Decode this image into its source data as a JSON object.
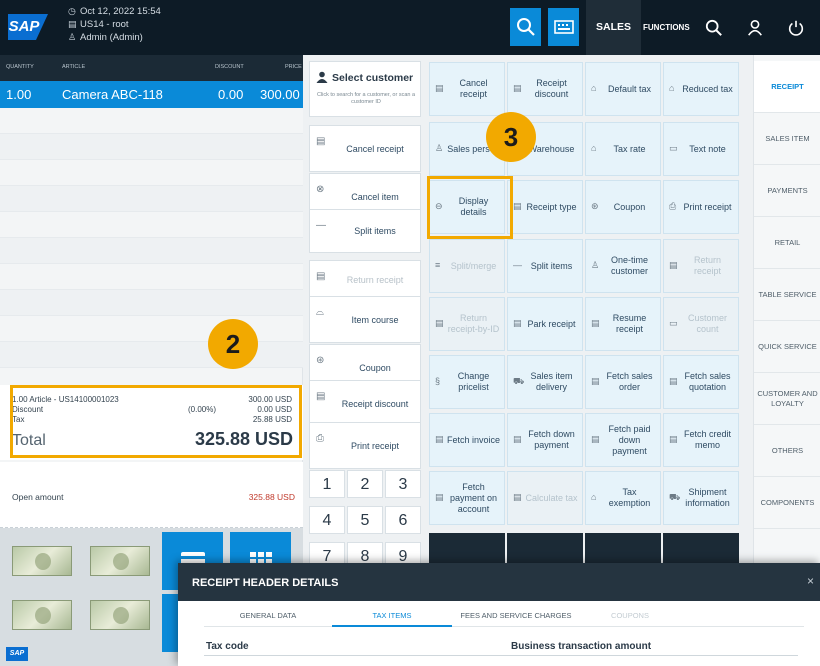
{
  "topbar": {
    "datetime": "Oct 12, 2022 15:54",
    "store": "US14 - root",
    "user": "Admin (Admin)",
    "logo": "SAP",
    "tab_sales": "SALES",
    "tab_functions": "FUNCTIONS",
    "icons": [
      "search-icon",
      "keyboard-icon",
      "search-icon",
      "user-icon",
      "power-icon"
    ]
  },
  "receipt": {
    "headers": {
      "quantity": "QUANTITY",
      "article": "ARTICLE",
      "discount": "DISCOUNT",
      "price": "PRICE"
    },
    "item": {
      "quantity": "1.00",
      "article": "Camera ABC-118",
      "discount": "0.00",
      "price": "300.00"
    },
    "summary": {
      "article_line": "1.00 Article - US14100001023",
      "article_amount": "300.00 USD",
      "discount_label": "Discount",
      "discount_pct": "(0.00%)",
      "discount_amount": "0.00 USD",
      "tax_label": "Tax",
      "tax_amount": "25.88 USD",
      "total_label": "Total",
      "total_amount": "325.88 USD"
    },
    "open_label": "Open amount",
    "open_amount": "325.88 USD",
    "bottom_logo": "SAP"
  },
  "middle": {
    "select_customer_title": "Select customer",
    "select_customer_hint": "Click to search for a customer, or scan a customer ID",
    "buttons": [
      {
        "label": "Cancel receipt",
        "icon": "receipt-icon",
        "disabled": false
      },
      {
        "label": "Cancel item",
        "icon": "cancel-item-icon",
        "disabled": false
      },
      {
        "label": "Split items",
        "icon": "minus-icon",
        "disabled": false
      },
      {
        "label": "Return receipt",
        "icon": "receipt-icon",
        "disabled": true
      },
      {
        "label": "Item course",
        "icon": "course-icon",
        "disabled": false
      },
      {
        "label": "Coupon",
        "icon": "coupon-icon",
        "disabled": false
      },
      {
        "label": "Receipt discount",
        "icon": "receipt-icon",
        "disabled": false
      },
      {
        "label": "Print receipt",
        "icon": "printer-icon",
        "disabled": false
      }
    ],
    "numpad": [
      "1",
      "2",
      "3",
      "4",
      "5",
      "6",
      "7",
      "8",
      "9"
    ]
  },
  "grid": {
    "rows": [
      [
        {
          "label": "Cancel receipt",
          "icon": "receipt-icon"
        },
        {
          "label": "Receipt discount",
          "icon": "discount-icon"
        },
        {
          "label": "Default tax",
          "icon": "tax-icon"
        },
        {
          "label": "Reduced tax",
          "icon": "tax-icon"
        }
      ],
      [
        {
          "label": "Sales person",
          "icon": "person-icon"
        },
        {
          "label": "Warehouse",
          "icon": "warehouse-icon"
        },
        {
          "label": "Tax rate",
          "icon": "tax-icon"
        },
        {
          "label": "Text note",
          "icon": "note-icon"
        }
      ],
      [
        {
          "label": "Display details",
          "icon": "details-icon"
        },
        {
          "label": "Receipt type",
          "icon": "receipt-icon"
        },
        {
          "label": "Coupon",
          "icon": "coupon-icon"
        },
        {
          "label": "Print receipt",
          "icon": "printer-icon"
        }
      ],
      [
        {
          "label": "Split/merge",
          "icon": "split-icon",
          "disabled": true
        },
        {
          "label": "Split items",
          "icon": "minus-icon"
        },
        {
          "label": "One-time customer",
          "icon": "person-icon"
        },
        {
          "label": "Return receipt",
          "icon": "receipt-icon",
          "disabled": true
        }
      ],
      [
        {
          "label": "Return receipt-by-ID",
          "icon": "receipt-icon",
          "disabled": true
        },
        {
          "label": "Park receipt",
          "icon": "park-icon"
        },
        {
          "label": "Resume receipt",
          "icon": "resume-icon"
        },
        {
          "label": "Customer count",
          "icon": "count-icon",
          "disabled": true
        }
      ],
      [
        {
          "label": "Change pricelist",
          "icon": "pricelist-icon"
        },
        {
          "label": "Sales item delivery",
          "icon": "delivery-icon"
        },
        {
          "label": "Fetch sales order",
          "icon": "fetch-icon"
        },
        {
          "label": "Fetch sales quotation",
          "icon": "fetch-icon"
        }
      ],
      [
        {
          "label": "Fetch invoice",
          "icon": "fetch-icon"
        },
        {
          "label": "Fetch down payment",
          "icon": "fetch-icon"
        },
        {
          "label": "Fetch paid down payment",
          "icon": "fetch-icon"
        },
        {
          "label": "Fetch credit memo",
          "icon": "fetch-icon"
        }
      ],
      [
        {
          "label": "Fetch payment on account",
          "icon": "fetch-icon"
        },
        {
          "label": "Calculate tax",
          "icon": "calc-icon",
          "disabled": true
        },
        {
          "label": "Tax exemption",
          "icon": "tax-icon"
        },
        {
          "label": "Shipment information",
          "icon": "shipment-icon"
        }
      ]
    ]
  },
  "tabs": [
    "RECEIPT",
    "SALES ITEM",
    "PAYMENTS",
    "RETAIL",
    "TABLE SERVICE",
    "QUICK SERVICE",
    "CUSTOMER AND LOYALTY",
    "OTHERS",
    "COMPONENTS"
  ],
  "callouts": {
    "two": "2",
    "three": "3"
  },
  "dialog": {
    "title": "RECEIPT HEADER DETAILS",
    "close": "×",
    "tabs": [
      "GENERAL DATA",
      "TAX ITEMS",
      "FEES AND SERVICE CHARGES",
      "COUPONS"
    ],
    "col_tax_code": "Tax code",
    "col_business_amount": "Business transaction amount"
  },
  "colors": {
    "accent": "#0a8ad8",
    "highlight": "#f2a900",
    "dark": "#1b2a36"
  }
}
